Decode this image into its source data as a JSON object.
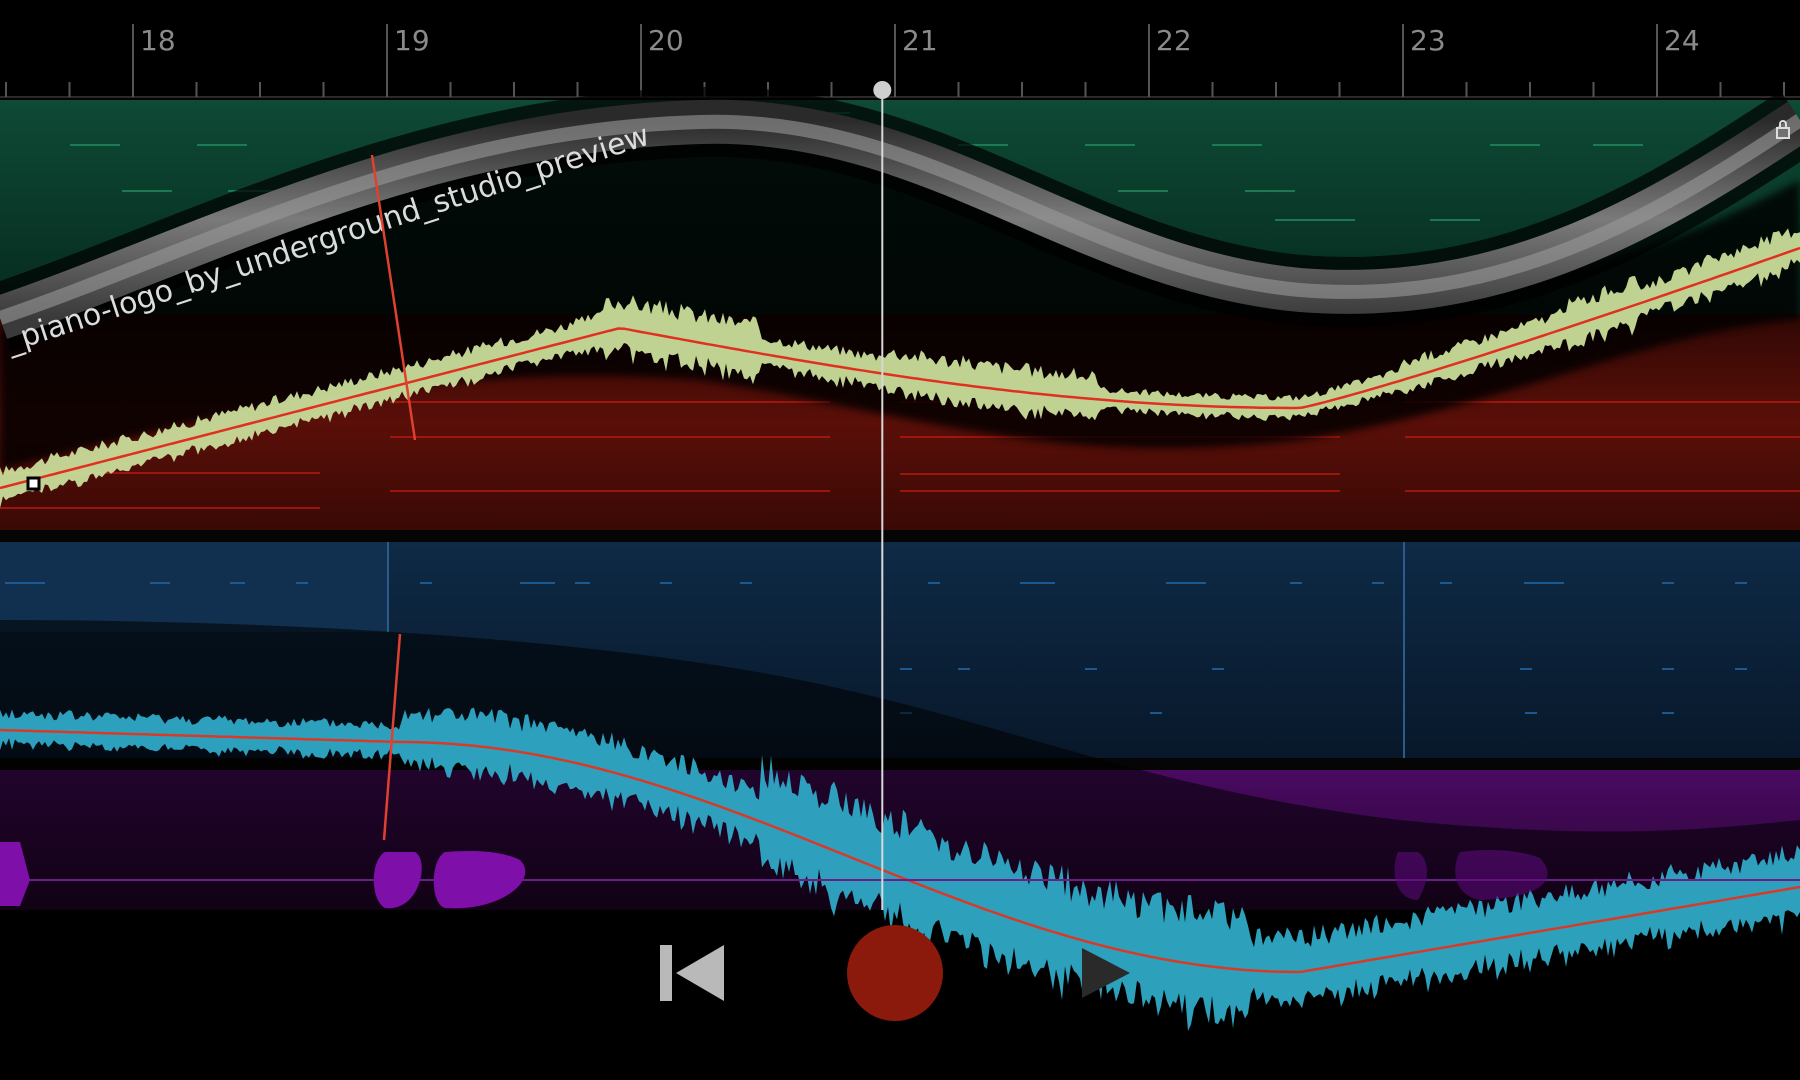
{
  "timeline": {
    "bars": [
      "18",
      "19",
      "20",
      "21",
      "22",
      "23",
      "24"
    ],
    "playhead_bar": 20.95
  },
  "clips": {
    "audio_clip_1": {
      "title": "_piano-logo_by_underground_studio_preview",
      "wave_color": "#c9dd9a",
      "envelope_color": "#e03020"
    },
    "audio_clip_2": {
      "wave_color": "#2fa9c6",
      "envelope_color": "#e03020"
    }
  },
  "tracks": {
    "green": {
      "color": "#0b3d2c"
    },
    "red": {
      "color": "#4a0c08"
    },
    "blue": {
      "color": "#0b1c30"
    },
    "purple": {
      "color": "#3d0650"
    }
  },
  "transport": {
    "back_icon": "skip-to-start-icon",
    "record_icon": "record-icon",
    "play_icon": "play-icon",
    "record_color": "#8b1a0c"
  }
}
